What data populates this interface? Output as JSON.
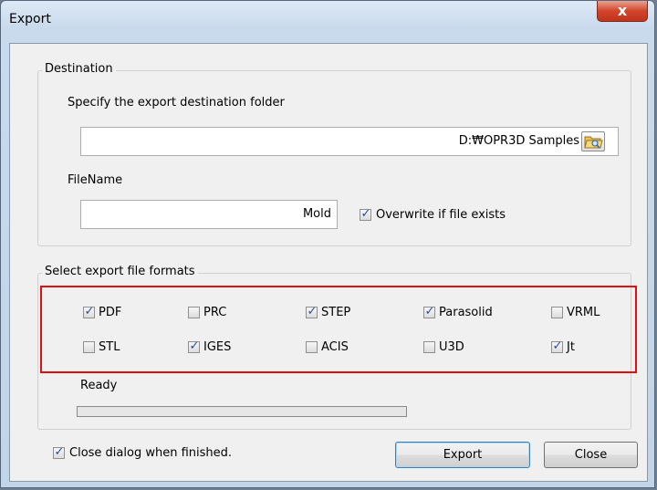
{
  "window": {
    "title": "Export",
    "close_glyph": "x"
  },
  "destination": {
    "legend": "Destination",
    "folder_prompt": "Specify the export destination folder",
    "folder_value": "D:₩OPR3D Samples",
    "filename_label": "FileName",
    "filename_value": "Mold",
    "overwrite_label": "Overwrite if file exists",
    "overwrite_checked": true
  },
  "formats": {
    "legend": "Select export file formats",
    "items": [
      {
        "label": "PDF",
        "checked": true
      },
      {
        "label": "PRC",
        "checked": false
      },
      {
        "label": "STEP",
        "checked": true
      },
      {
        "label": "Parasolid",
        "checked": true
      },
      {
        "label": "VRML",
        "checked": false
      },
      {
        "label": "STL",
        "checked": false
      },
      {
        "label": "IGES",
        "checked": true
      },
      {
        "label": "ACIS",
        "checked": false
      },
      {
        "label": "U3D",
        "checked": false
      },
      {
        "label": "Jt",
        "checked": true
      }
    ],
    "status": "Ready",
    "progress": 0
  },
  "footer": {
    "close_when_finished_label": "Close dialog when finished.",
    "close_when_finished_checked": true,
    "export_button": "Export",
    "close_button": "Close"
  },
  "colors": {
    "highlight_box": "#e01010",
    "check_mark": "#2a4c9c"
  },
  "icons": {
    "folder_button": "folder-open-icon",
    "checkmark": "checkmark-icon"
  }
}
